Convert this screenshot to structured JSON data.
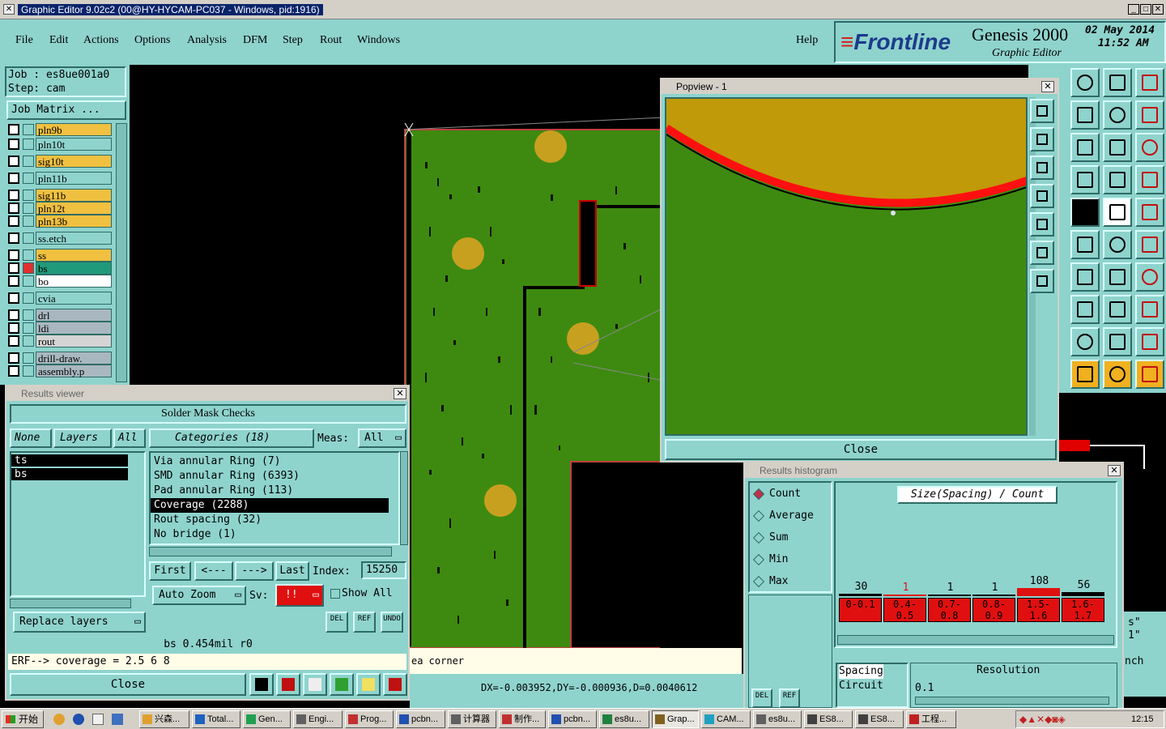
{
  "window": {
    "title": "Graphic Editor 9.02c2 (00@HY-HYCAM-PC037 - Windows, pid:1916)"
  },
  "menu": {
    "items": [
      "File",
      "Edit",
      "Actions",
      "Options",
      "Analysis",
      "DFM",
      "Step",
      "Rout",
      "Windows"
    ],
    "help": "Help"
  },
  "brand": {
    "logo": "Frontline",
    "product": "Genesis 2000",
    "subtitle": "Graphic Editor",
    "date": "02 May 2014",
    "time": "11:52 AM"
  },
  "job": {
    "job_label": "Job : es8ue001a0",
    "step_label": "Step: cam",
    "matrix_btn": "Job Matrix ..."
  },
  "layers": [
    {
      "name": "pln9b",
      "color": "#f0c040"
    },
    {
      "name": "pln10t",
      "color": "#8fd3cd"
    },
    {
      "name": "sig10t",
      "color": "#f0c040"
    },
    {
      "name": "pln11b",
      "color": "#8fd3cd"
    },
    {
      "name": "sig11b",
      "color": "#f0c040"
    },
    {
      "name": "pln12t",
      "color": "#f0c040"
    },
    {
      "name": "pln13b",
      "color": "#f0c040"
    },
    {
      "name": "ss.etch",
      "color": "#8fd3cd"
    },
    {
      "name": "ss",
      "color": "#f0c040"
    },
    {
      "name": "bs",
      "color": "#1f9a7a"
    },
    {
      "name": "bo",
      "color": "#ffffff"
    },
    {
      "name": "cvia",
      "color": "#8fd3cd"
    },
    {
      "name": "drl",
      "color": "#a9b8c0"
    },
    {
      "name": "ldi",
      "color": "#a9b8c0"
    },
    {
      "name": "rout",
      "color": "#d4d4d4"
    },
    {
      "name": "drill-draw.",
      "color": "#a9b8c0"
    },
    {
      "name": "assembly.p",
      "color": "#a9b8c0"
    }
  ],
  "results_viewer": {
    "title": "Results viewer",
    "header": "Solder Mask Checks",
    "none_btn": "None",
    "layers_btn": "Layers",
    "all_btn": "All",
    "layer_list": [
      "ts",
      "bs"
    ],
    "categories_label": "Categories (18)",
    "meas_label": "Meas:",
    "meas_value": "All",
    "categories": [
      "Via annular Ring (7)",
      "SMD annular Ring (6393)",
      "Pad annular Ring (113)",
      "Coverage (2288)",
      "Rout spacing (32)",
      "No bridge (1)"
    ],
    "nav": {
      "first": "First",
      "prev": "<---",
      "next": "--->",
      "last": "Last",
      "index_label": "Index:",
      "index_value": "15250"
    },
    "auto_zoom": "Auto Zoom",
    "sv_label": "Sv:",
    "sv_value": "!!",
    "show_all": "Show All",
    "replace_layers": "Replace layers",
    "small_btns": [
      "DEL",
      "REF",
      "UNDO"
    ],
    "info": "bs 0.454mil   r0",
    "erf": "ERF--> coverage = 2.5 6 8",
    "close": "Close"
  },
  "popview": {
    "title": "Popview - 1",
    "close": "Close"
  },
  "status": {
    "hint": "ea corner",
    "coords": "DX=-0.003952,DY=-0.000936,D=0.0040612"
  },
  "histogram": {
    "title": "Results histogram",
    "modes": [
      "Count",
      "Average",
      "Sum",
      "Min",
      "Max"
    ],
    "selected_mode": "Count",
    "chart_title": "Size(Spacing) / Count",
    "bins": [
      {
        "range": "0-0.1",
        "count": "30"
      },
      {
        "range": "0.4-0.5",
        "count": "1"
      },
      {
        "range": "0.7-0.8",
        "count": "1"
      },
      {
        "range": "0.8-0.9",
        "count": "1"
      },
      {
        "range": "1.5-1.6",
        "count": "108"
      },
      {
        "range": "1.6-1.7",
        "count": "56"
      }
    ],
    "types": [
      "Spacing",
      "Circuit"
    ],
    "resolution_label": "Resolution",
    "resolution_value": "0.1",
    "small_btns": [
      "DEL",
      "REF"
    ]
  },
  "side_labels": {
    "nch": "nch",
    "s": "s\"",
    "one": "1\""
  },
  "taskbar": {
    "start": "开始",
    "items": [
      "兴森...",
      "Total...",
      "Gen...",
      "Engi...",
      "Prog...",
      "pcbn...",
      "计算器",
      "制作...",
      "pcbn...",
      "es8u...",
      "Grap...",
      "CAM...",
      "es8u...",
      "ES8...",
      "ES8...",
      "工程..."
    ],
    "time": "12:15"
  }
}
